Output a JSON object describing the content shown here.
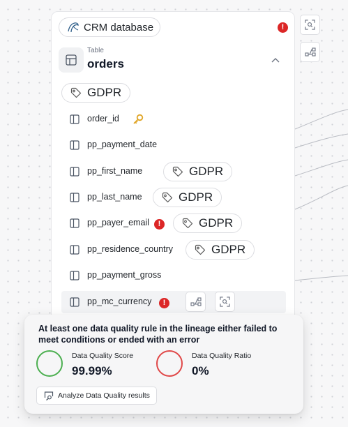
{
  "node": {
    "database_label": "CRM database",
    "database_icon": "dolphin-icon",
    "error_mark": "!",
    "table_kind": "Table",
    "table_name": "orders",
    "table_tag": "GDPR"
  },
  "columns": [
    {
      "name": "order_id",
      "key": true
    },
    {
      "name": "pp_payment_date"
    },
    {
      "name": "pp_first_name",
      "tag": "GDPR"
    },
    {
      "name": "pp_last_name",
      "tag": "GDPR"
    },
    {
      "name": "pp_payer_email",
      "error": "!",
      "tag": "GDPR"
    },
    {
      "name": "pp_residence_country",
      "tag": "GDPR"
    },
    {
      "name": "pp_payment_gross"
    },
    {
      "name": "pp_mc_currency",
      "error": "!",
      "selected": true
    }
  ],
  "tooltip": {
    "message": "At least one data quality rule in the lineage either failed to meet conditions or ended with an error",
    "score_label": "Data Quality Score",
    "score_value": "99.99%",
    "ratio_label": "Data Quality Ratio",
    "ratio_value": "0%",
    "analyze_button": "Analyze Data Quality results"
  },
  "colors": {
    "error": "#dc2626",
    "good_ring": "#4caf50",
    "bad_ring": "#e04848",
    "key": "#e0a526",
    "edge": "#b9bcc3"
  }
}
